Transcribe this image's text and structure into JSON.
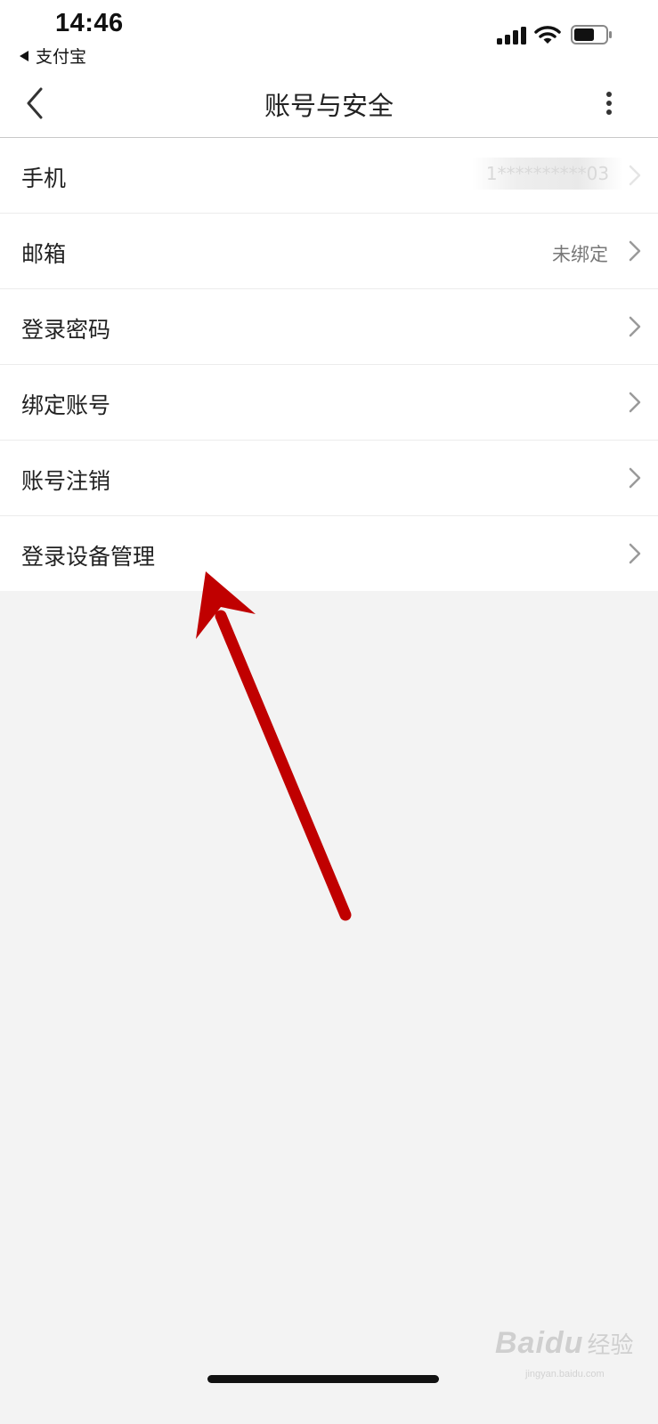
{
  "status_bar": {
    "time": "14:46",
    "back_app_label": "支付宝",
    "icons": [
      "signal-icon",
      "wifi-icon",
      "battery-icon"
    ],
    "battery_level": 0.65
  },
  "nav": {
    "title": "账号与安全",
    "back_icon": "chevron-left-icon",
    "more_icon": "more-vertical-icon"
  },
  "list": {
    "items": [
      {
        "label": "手机",
        "value": "1**********03"
      },
      {
        "label": "邮箱",
        "value": "未绑定"
      },
      {
        "label": "登录密码",
        "value": ""
      },
      {
        "label": "绑定账号",
        "value": ""
      },
      {
        "label": "账号注销",
        "value": ""
      },
      {
        "label": "登录设备管理",
        "value": ""
      }
    ]
  },
  "annotation": {
    "type": "arrow",
    "color": "#c00000",
    "points_to": "登录设备管理"
  },
  "watermark": {
    "brand": "Baidu",
    "cn": "经验",
    "url": "jingyan.baidu.com"
  },
  "colors": {
    "background": "#f3f3f3",
    "surface": "#ffffff",
    "text": "#222222",
    "secondary_text": "#777777",
    "chevron": "#9a9a9a"
  }
}
